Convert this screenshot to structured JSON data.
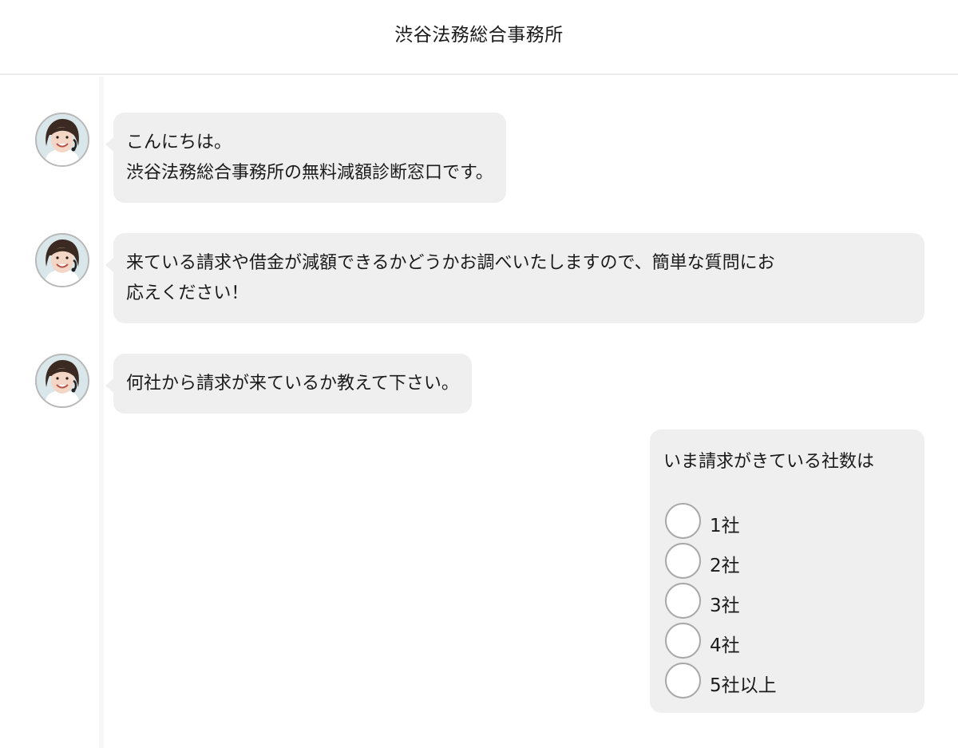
{
  "header": {
    "title": "渋谷法務総合事務所"
  },
  "messages": [
    {
      "lines": [
        "こんにちは。",
        "渋谷法務総合事務所の無料減額診断窓口です。"
      ]
    },
    {
      "lines": [
        "来ている請求や借金が減額できるかどうかお調べいたしますので、簡単な質問にお",
        "応えください！"
      ]
    },
    {
      "lines": [
        "何社から請求が来ているか教えて下さい。"
      ]
    }
  ],
  "form": {
    "question": "いま請求がきている社数は",
    "options": [
      {
        "label": "1社",
        "selected": false
      },
      {
        "label": "2社",
        "selected": false
      },
      {
        "label": "3社",
        "selected": false
      },
      {
        "label": "4社",
        "selected": false
      },
      {
        "label": "5社以上",
        "selected": false
      }
    ]
  },
  "avatar_icon": "operator-avatar-icon",
  "colors": {
    "bubble": "#efefef",
    "radio_border": "#a8a8a8",
    "header_divider": "#ececec"
  }
}
